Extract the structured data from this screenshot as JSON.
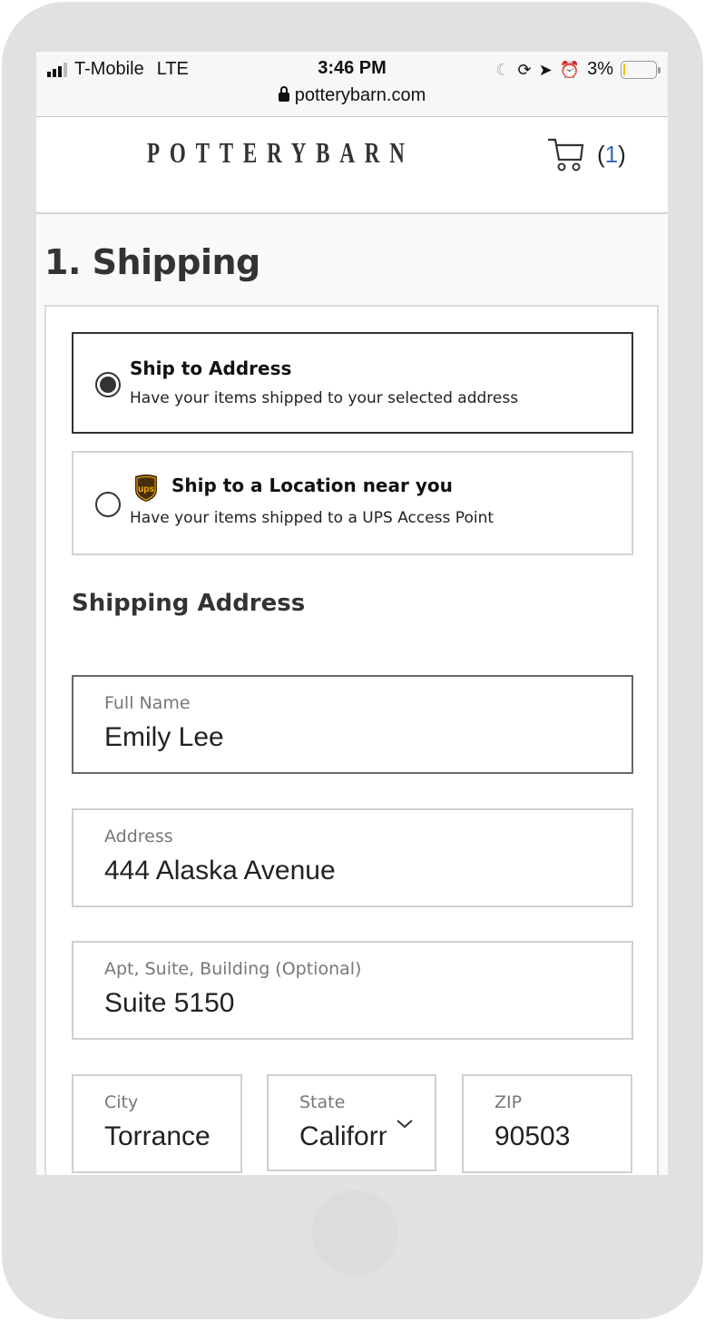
{
  "status_bar": {
    "carrier": "T-Mobile",
    "network": "LTE",
    "time": "3:46 PM",
    "battery": "3%",
    "battery_level_percent": 3,
    "icons": [
      "signal-icon",
      "moon-icon",
      "orientation-lock-icon",
      "location-icon",
      "alarm-icon",
      "battery-icon"
    ]
  },
  "browser": {
    "url": "potterybarn.com",
    "secure_icon": "lock-icon"
  },
  "header": {
    "logo": "POTTERYBARN",
    "cart_icon": "cart-icon",
    "cart_count_open": "(",
    "cart_count": "1",
    "cart_count_close": ")"
  },
  "page": {
    "title": "1. Shipping"
  },
  "shipping_options": [
    {
      "title": "Ship to Address",
      "description": "Have your items shipped to your selected address",
      "selected": true
    },
    {
      "title": "Ship to a Location near you",
      "description": "Have your items shipped to a UPS Access Point",
      "selected": false,
      "icon": "ups-logo-icon"
    }
  ],
  "shipping_address": {
    "heading": "Shipping Address",
    "fields": {
      "full_name": {
        "label": "Full Name",
        "value": "Emily Lee"
      },
      "address": {
        "label": "Address",
        "value": "444 Alaska Avenue"
      },
      "apt": {
        "label": "Apt, Suite, Building (Optional)",
        "value": "Suite 5150"
      },
      "city": {
        "label": "City",
        "value": "Torrance"
      },
      "state": {
        "label": "State",
        "value": "California"
      },
      "zip": {
        "label": "ZIP",
        "value": "90503"
      }
    }
  },
  "colors": {
    "frame": "#e1e1e1",
    "text_dark": "#333333",
    "cart_count_accent": "#3a6ab0",
    "ups_brown": "#4a2c0e",
    "ups_gold": "#f5b400"
  }
}
